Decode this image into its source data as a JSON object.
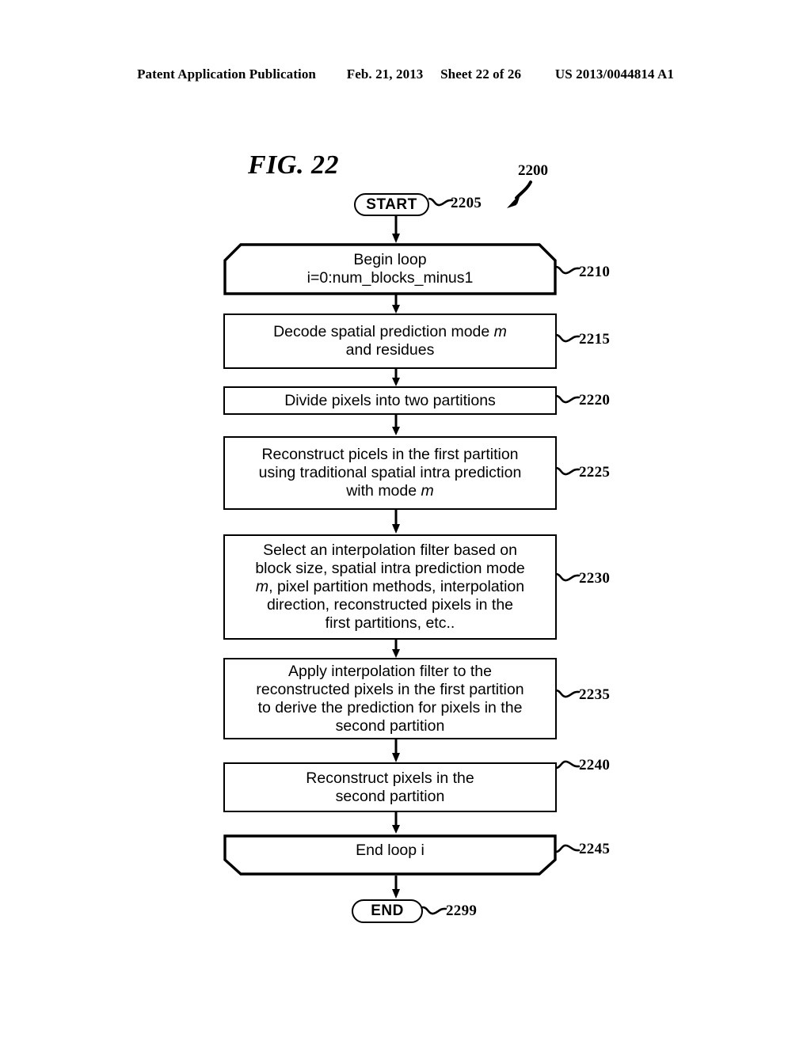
{
  "header": {
    "publication": "Patent Application Publication",
    "date": "Feb. 21, 2013",
    "sheet": "Sheet 22 of 26",
    "pub_number": "US 2013/0044814 A1"
  },
  "figure": {
    "title": "FIG. 22",
    "figure_ref": "2200"
  },
  "flowchart": {
    "type": "flowchart",
    "nodes": [
      {
        "id": "start",
        "shape": "terminator",
        "label": "START",
        "ref": "2205"
      },
      {
        "id": "begin-loop",
        "shape": "loop-begin",
        "line1": "Begin loop",
        "line2": "i=0:num_blocks_minus1",
        "ref": "2210"
      },
      {
        "id": "decode",
        "shape": "process",
        "line1": "Decode spatial prediction mode ",
        "em1": "m",
        "line2": "and residues",
        "ref": "2215"
      },
      {
        "id": "divide",
        "shape": "process",
        "line1": "Divide pixels into two partitions",
        "ref": "2220"
      },
      {
        "id": "reconstruct-first",
        "shape": "process",
        "line1": "Reconstruct picels in the first partition",
        "line2": "using traditional spatial intra prediction",
        "line3": "with mode ",
        "em3": "m",
        "ref": "2225"
      },
      {
        "id": "select-filter",
        "shape": "process",
        "line1": "Select an interpolation filter based on",
        "line2": "block size, spatial intra prediction mode",
        "line3pre": "",
        "em3": "m",
        "line3post": ", pixel partition methods, interpolation",
        "line4": "direction, reconstructed pixels in the",
        "line5": "first partitions, etc..",
        "ref": "2230"
      },
      {
        "id": "apply-filter",
        "shape": "process",
        "line1": "Apply interpolation filter to the",
        "line2": "reconstructed pixels in the first partition",
        "line3": "to derive the prediction for pixels in the",
        "line4": "second partition",
        "ref": "2235"
      },
      {
        "id": "reconstruct-second",
        "shape": "process",
        "line1": "Reconstruct pixels in the",
        "line2": "second partition",
        "ref": "2240"
      },
      {
        "id": "end-loop",
        "shape": "loop-end",
        "line1": "End loop i",
        "ref": "2245"
      },
      {
        "id": "end",
        "shape": "terminator",
        "label": "END",
        "ref": "2299"
      }
    ],
    "edges": [
      {
        "from": "start",
        "to": "begin-loop"
      },
      {
        "from": "begin-loop",
        "to": "decode"
      },
      {
        "from": "decode",
        "to": "divide"
      },
      {
        "from": "divide",
        "to": "reconstruct-first"
      },
      {
        "from": "reconstruct-first",
        "to": "select-filter"
      },
      {
        "from": "select-filter",
        "to": "apply-filter"
      },
      {
        "from": "apply-filter",
        "to": "reconstruct-second"
      },
      {
        "from": "reconstruct-second",
        "to": "end-loop"
      },
      {
        "from": "end-loop",
        "to": "end"
      }
    ]
  },
  "colors": {
    "ink": "#000000",
    "paper": "#ffffff"
  }
}
